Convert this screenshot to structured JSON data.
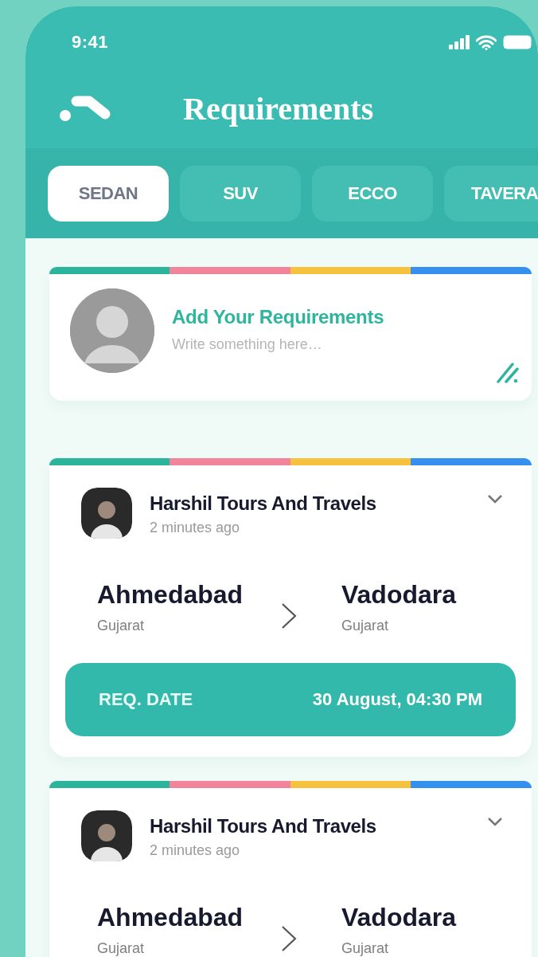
{
  "status_bar": {
    "time": "9:41"
  },
  "header": {
    "title": "Requirements"
  },
  "tabs": [
    {
      "label": "SEDAN",
      "selected": true
    },
    {
      "label": "SUV",
      "selected": false
    },
    {
      "label": "ECCO",
      "selected": false
    },
    {
      "label": "TAVERA",
      "selected": false
    }
  ],
  "composer": {
    "title": "Add Your Requirements",
    "placeholder": "Write something here…"
  },
  "requests": [
    {
      "company": "Harshil Tours And Travels",
      "time_ago": "2 minutes ago",
      "from": {
        "city": "Ahmedabad",
        "state": "Gujarat"
      },
      "to": {
        "city": "Vadodara",
        "state": "Gujarat"
      },
      "date_label": "REQ. DATE",
      "date_value": "30 August, 04:30 PM"
    },
    {
      "company": "Harshil Tours And Travels",
      "time_ago": "2 minutes ago",
      "from": {
        "city": "Ahmedabad",
        "state": "Gujarat"
      },
      "to": {
        "city": "Vadodara",
        "state": "Gujarat"
      }
    }
  ]
}
